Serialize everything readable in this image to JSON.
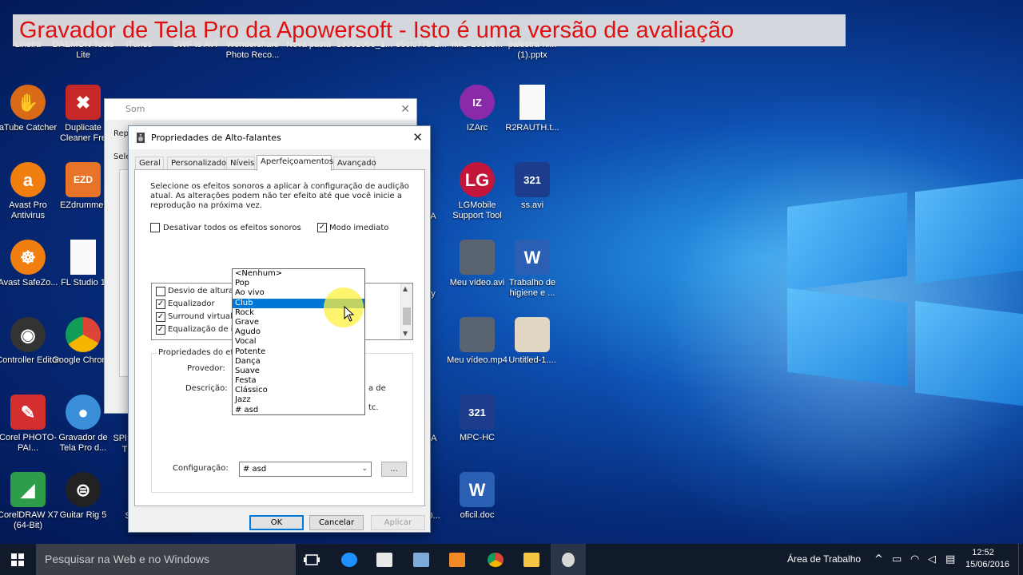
{
  "watermark": "Gravador de Tela Pro da Apowersoft - Isto é uma versão de avaliação",
  "desktop_icons": {
    "lixeira": "Lixeira",
    "daemon": "DAEMON Tools Lite",
    "itunes": "iTunes",
    "swf": "SWF to AVI",
    "wondershare": "Wondershare Photo Reco...",
    "nova_pasta": "Nova pasta",
    "file1": "13062056_1...",
    "file2": "e5cfc77b-2...",
    "img": "IMG-20160...",
    "palestra": "palestra-hi... (1).pptx",
    "atube": "aTube Catcher",
    "duplicate": "Duplicate Cleaner Fre",
    "izarc": "IZArc",
    "r2rauth": "R2RAUTH.t...",
    "avast": "Avast Pro Antivirus",
    "ezdrummer": "EZdrummer",
    "lgmobile": "LGMobile Support Tool",
    "ssavi": "ss.avi",
    "safezone": "Avast SafeZo...",
    "flstudio": "FL Studio 1",
    "meu_video_avi": "Meu vídeo.avi",
    "trabalho": "Trabalho de higiene e ...",
    "controller": "Controller Editor",
    "chrome": "Google Chrome",
    "meu_video_mp4": "Meu vídeo.mp4",
    "untitled": "Untitled-1....",
    "corel_paint": "Corel PHOTO-PAI...",
    "gravador": "Gravador de Tela Pro d...",
    "mpchc": "MPC-HC",
    "coreldraw": "CorelDRAW X7 (64-Bit)",
    "guitar_rig": "Guitar Rig 5",
    "oficil": "oficil.doc",
    "frag_ake": "ake",
    "frag_60": "60...",
    "frag_ja": "JA",
    "frag_a": "A",
    "frag_y": "y",
    "frag_spl": "SPl",
    "frag_t": "T",
    "frag_s": "S"
  },
  "som_window": {
    "title": "Som",
    "frag_rep": "Rep",
    "frag_sele": "Sele"
  },
  "dialog": {
    "title": "Propriedades de Alto-falantes",
    "tabs": [
      "Geral",
      "Personalizado",
      "Níveis",
      "Aperfeiçoamentos",
      "Avançado"
    ],
    "intro": "Selecione os efeitos sonoros a aplicar à configuração de audição atual. As alterações podem não ter efeito até que você inicie a reprodução na próxima vez.",
    "disable_all": "Desativar todos os efeitos sonoros",
    "immediate_mode": "Modo imediato",
    "effects": [
      {
        "label": "Desvio de altura",
        "checked": false
      },
      {
        "label": "Equalizador",
        "checked": true
      },
      {
        "label": "Surround virtual",
        "checked": true
      },
      {
        "label": "Equalização de int",
        "checked": true
      }
    ],
    "props_legend": "Propriedades do efei",
    "provider_label": "Provedor:",
    "description_label": "Descrição:",
    "desc_frag1": "a de",
    "desc_frag2": "tc.",
    "config_label": "Configuração:",
    "config_value": "# asd",
    "dots_label": "...",
    "ok": "OK",
    "cancel": "Cancelar",
    "apply": "Aplicar"
  },
  "dropdown_options": [
    "<Nenhum>",
    "Pop",
    "Ao vivo",
    "Club",
    "Rock",
    "Grave",
    "Agudo",
    "Vocal",
    "Potente",
    "Dança",
    "Suave",
    "Festa",
    "Clássico",
    "Jazz",
    "# asd"
  ],
  "dropdown_selected": "Club",
  "taskbar": {
    "search_placeholder": "Pesquisar na Web e no Windows",
    "desktop_label": "Área de Trabalho",
    "time": "12:52",
    "date": "15/06/2016"
  },
  "colors": {
    "watermark_text": "#e01010",
    "selection": "#0078d7",
    "taskbar": "#101a2a"
  }
}
